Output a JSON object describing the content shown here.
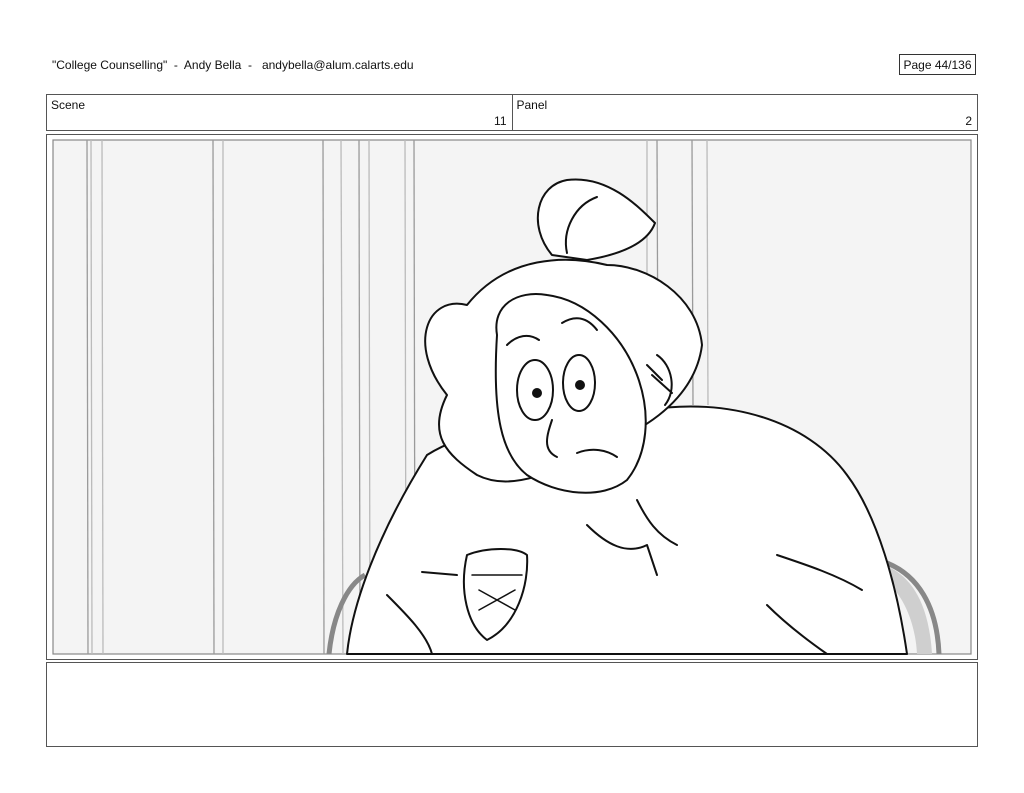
{
  "header": {
    "title": "\"College Counselling\"  -  Andy Bella  -   andybella@alum.calarts.edu",
    "page": "Page  44/136"
  },
  "scene": {
    "label": "Scene",
    "value": "11"
  },
  "panel": {
    "label": "Panel",
    "value": "2"
  },
  "notes": {
    "text": ""
  }
}
